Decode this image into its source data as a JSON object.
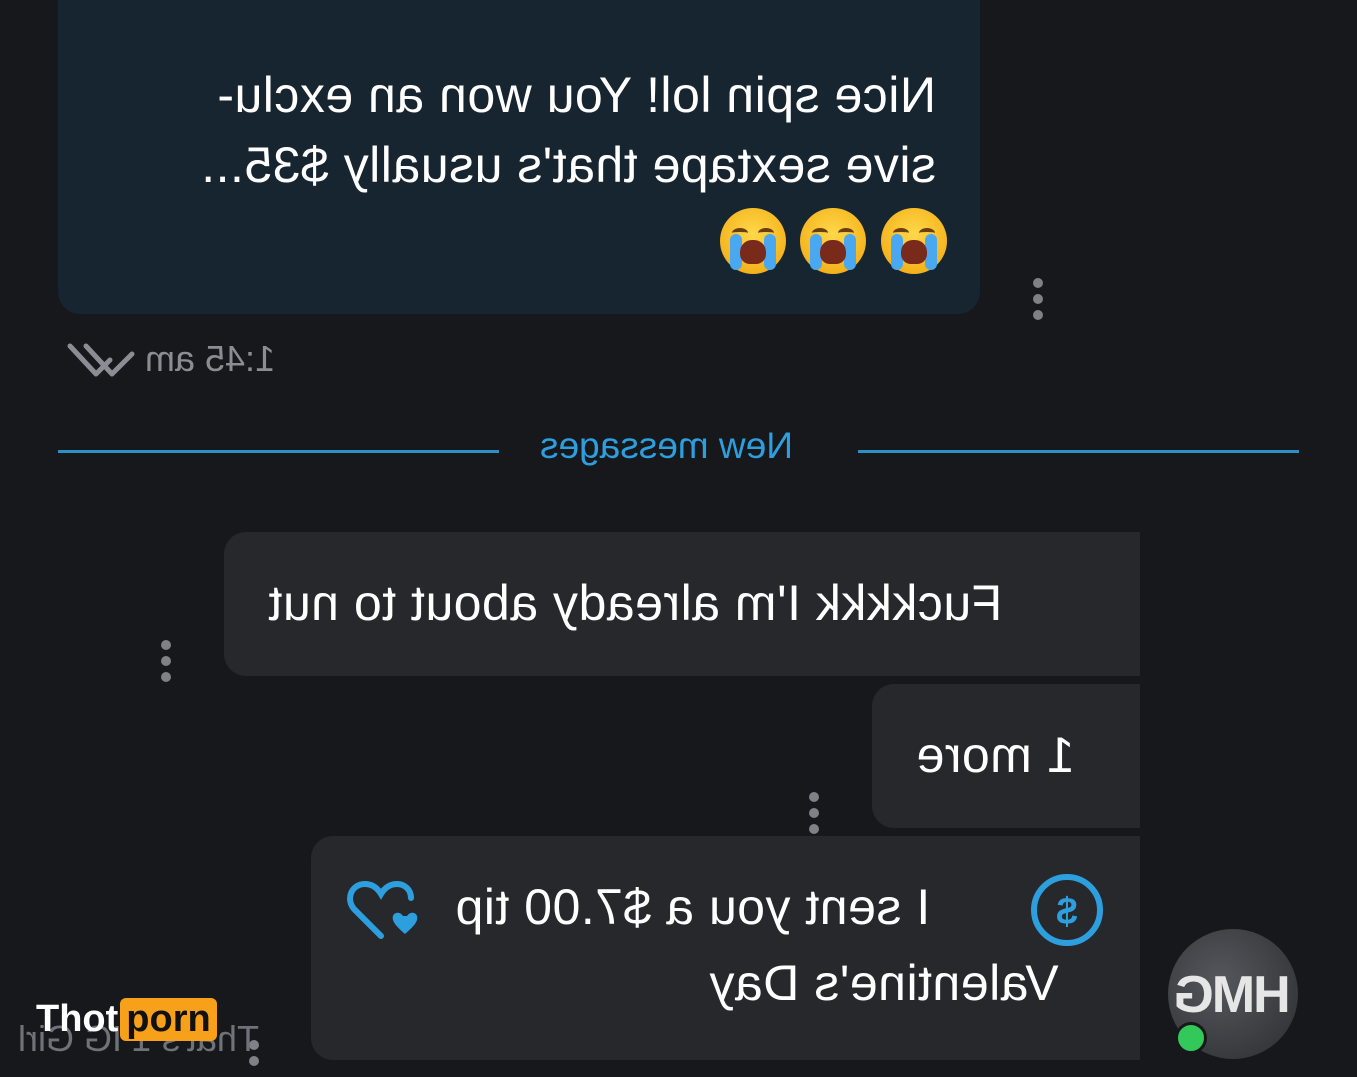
{
  "outgoing": {
    "lines": [
      "Nice spin lol! You won an exclu-",
      "sive sextape that's usually $35..."
    ],
    "emojis": [
      "loudly-crying-face-emoji",
      "loudly-crying-face-emoji",
      "loudly-crying-face-emoji"
    ],
    "time": "1:45 am",
    "status_icon": "double-check-icon"
  },
  "divider": {
    "label": "New messages"
  },
  "incoming": [
    {
      "text": "Fuckkkk I'm already about to nut"
    },
    {
      "text": "1 more"
    },
    {
      "tip_text": "I sent you a $7.00 tip",
      "caption": "Valentine's Day",
      "tip_icon": "dollar-circle-icon",
      "like_icon": "heart-plus-icon"
    }
  ],
  "avatar": {
    "initials": "HMG",
    "online": true
  },
  "watermark": {
    "part1": "Thot",
    "part2": "porn"
  },
  "footer_ghost_text": "That's 1 IG Girl",
  "colors": {
    "accent": "#2d9fde",
    "outgoing_bubble": "#172530",
    "incoming_bubble": "#27282c",
    "background": "#17181b",
    "online": "#32c85a",
    "brand": "#f7a11a"
  }
}
